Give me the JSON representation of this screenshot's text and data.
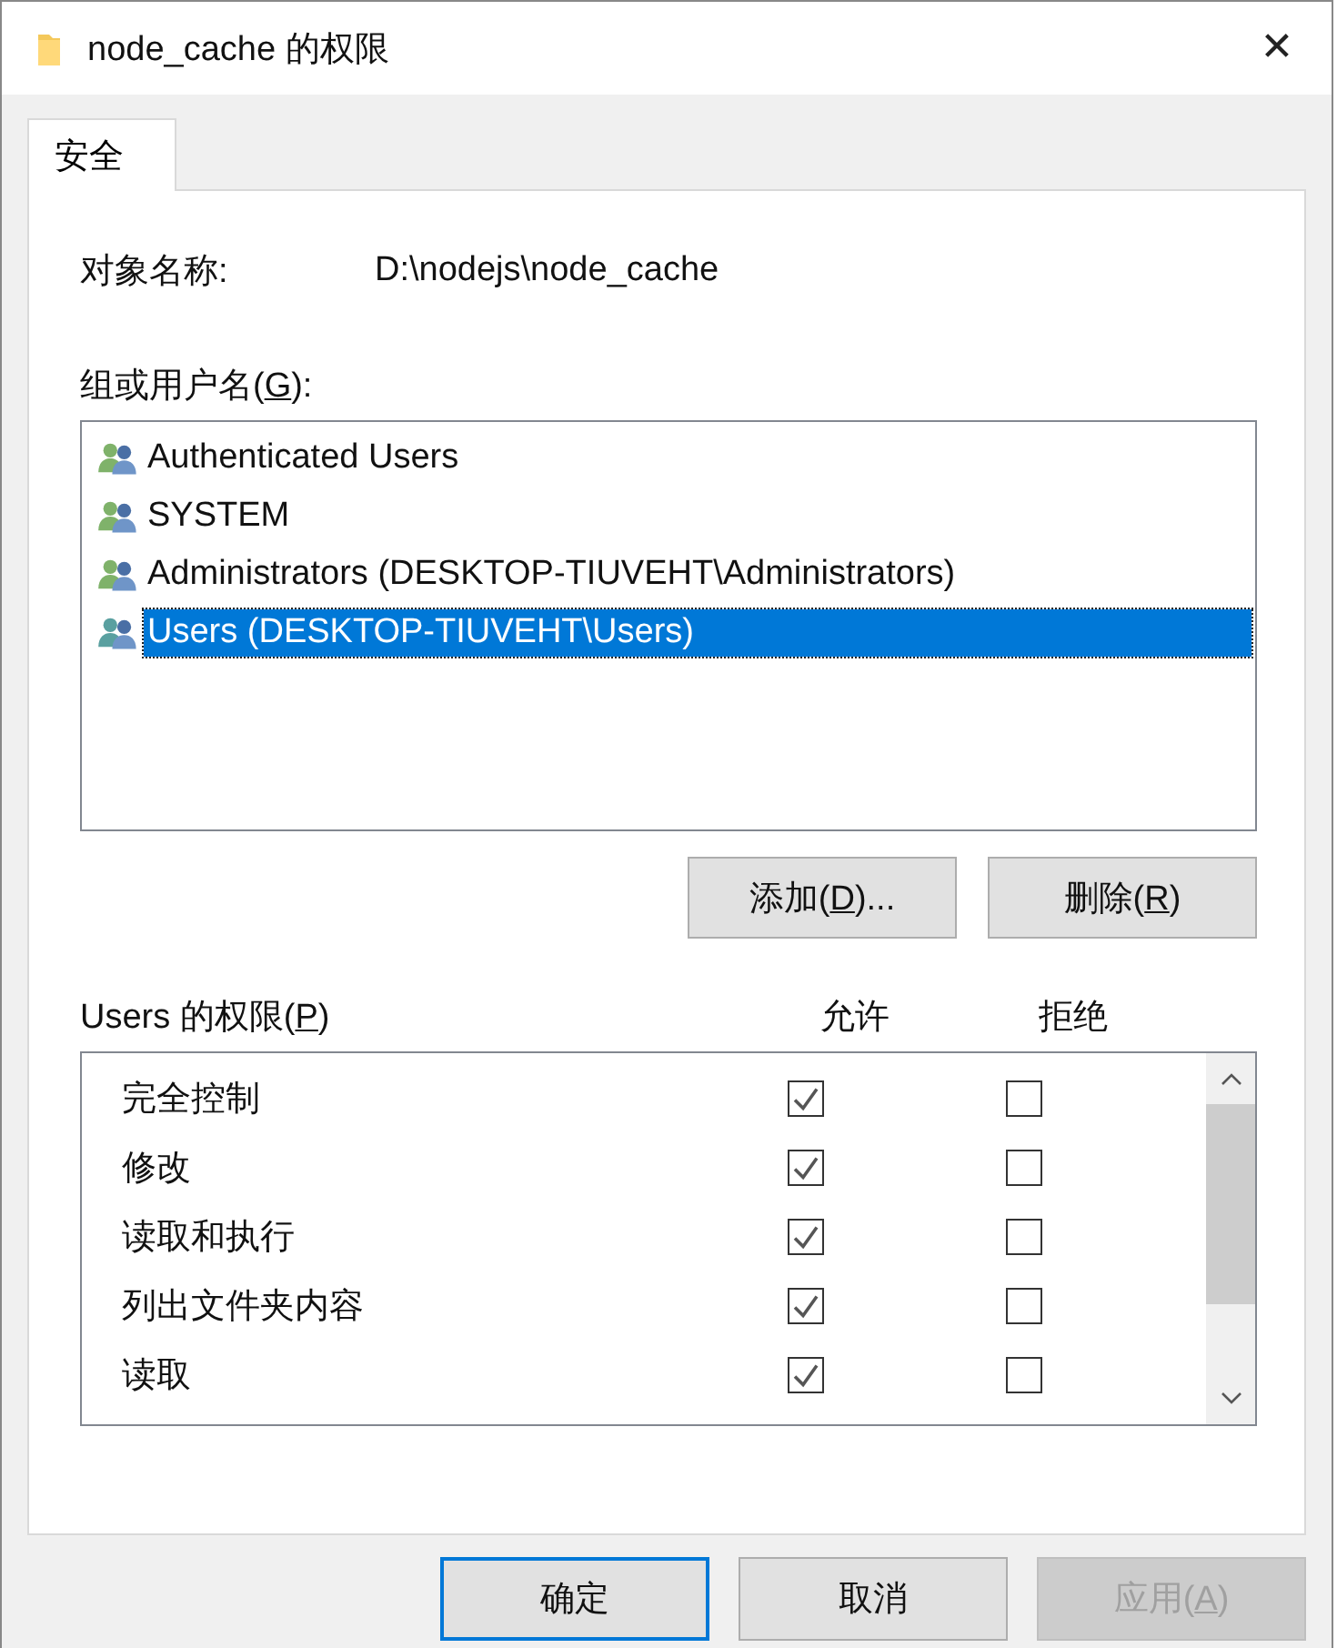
{
  "window": {
    "title": "node_cache 的权限",
    "close": "✕"
  },
  "tabs": [
    {
      "label": "安全",
      "selected": true
    }
  ],
  "object_name": {
    "label": "对象名称:",
    "value": "D:\\nodejs\\node_cache"
  },
  "group_label": {
    "before": "组或用户名(",
    "key": "G",
    "after": "):"
  },
  "users": [
    {
      "name": "Authenticated Users",
      "selected": false
    },
    {
      "name": "SYSTEM",
      "selected": false
    },
    {
      "name": "Administrators (DESKTOP-TIUVEHT\\Administrators)",
      "selected": false
    },
    {
      "name": "Users (DESKTOP-TIUVEHT\\Users)",
      "selected": true
    }
  ],
  "user_buttons": [
    {
      "before": "添加(",
      "key": "D",
      "after": ")..."
    },
    {
      "before": "删除(",
      "key": "R",
      "after": ")"
    }
  ],
  "permissions_label": {
    "before": "Users 的权限(",
    "key": "P",
    "after": ")"
  },
  "permission_columns": [
    "允许",
    "拒绝"
  ],
  "permissions": [
    {
      "name": "完全控制",
      "allow": true,
      "deny": false
    },
    {
      "name": "修改",
      "allow": true,
      "deny": false
    },
    {
      "name": "读取和执行",
      "allow": true,
      "deny": false
    },
    {
      "name": "列出文件夹内容",
      "allow": true,
      "deny": false
    },
    {
      "name": "读取",
      "allow": true,
      "deny": false
    }
  ],
  "buttons": [
    {
      "before": "确定",
      "focused": true,
      "disabled": false
    },
    {
      "before": "取消",
      "focused": false,
      "disabled": false
    },
    {
      "before": "应用(",
      "key": "A",
      "after": ")",
      "focused": false,
      "disabled": true
    }
  ]
}
